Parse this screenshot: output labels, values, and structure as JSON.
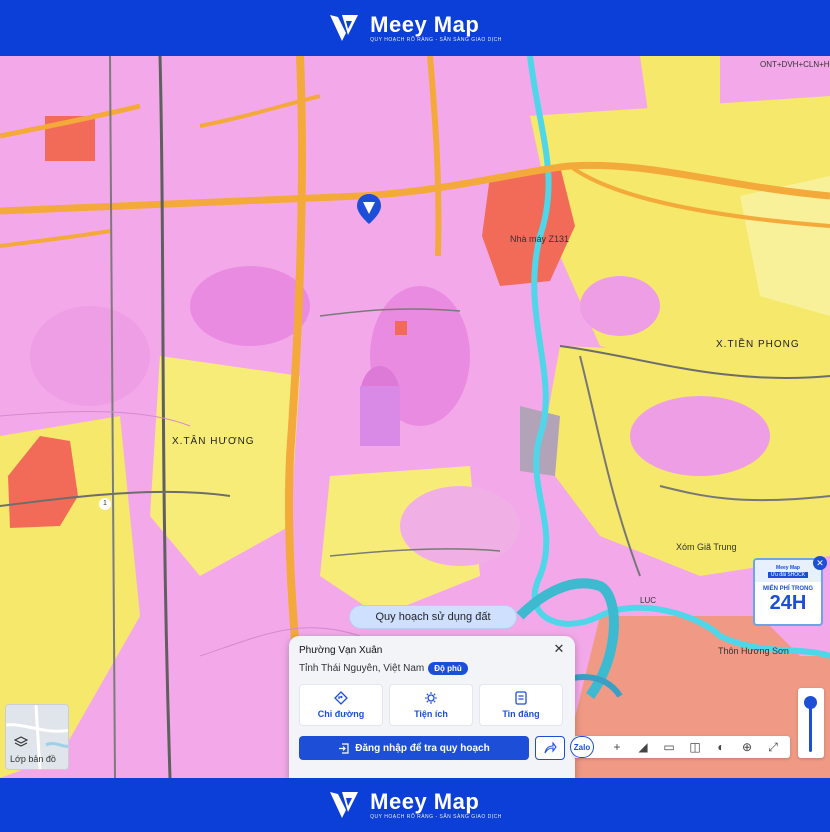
{
  "brand": {
    "name": "Meey Map",
    "tagline": "QUY HOẠCH RÕ RÀNG - SẴN SÀNG GIAO DỊCH"
  },
  "map": {
    "labels": {
      "factory": "Nhà máy Z131",
      "tien_phong": "X.TIỀN PHONG",
      "tan_huong": "X.TÂN HƯƠNG",
      "huong_son": "Thôn Hương Sơn",
      "xom_gia_trung": "Xóm Giã Trung",
      "road_1": "1",
      "luc": "LUC",
      "ont": "ONT+DVH+CLN+HNK"
    }
  },
  "plan_type_button": {
    "label": "Quy hoạch sử dụng đất"
  },
  "popup": {
    "title": "Phường Vạn Xuân",
    "location": "Tỉnh Thái Nguyên, Việt Nam",
    "badge": "Độ phủ",
    "actions": [
      {
        "label": "Chỉ đường",
        "icon": "directions-icon"
      },
      {
        "label": "Tiện ích",
        "icon": "amenities-icon"
      },
      {
        "label": "Tin đăng",
        "icon": "listing-icon"
      }
    ],
    "login_button": "Đăng nhập để tra quy hoạch",
    "close_symbol": "✕"
  },
  "layer_control": {
    "label": "Lớp bản đồ"
  },
  "toolbar": {
    "zalo": "Zalo",
    "items": [
      "−",
      "+",
      "◢",
      "▭",
      "◫",
      "◐",
      "⊕",
      "⤢"
    ]
  },
  "promo": {
    "brand": "Meey Map",
    "shock": "Ưu đãi SHOCK",
    "free_text": "MIỄN PHÍ TRONG",
    "hours": "24H"
  },
  "colors": {
    "brand_blue": "#0c3ed8",
    "residential_pink": "#f3a9e9",
    "agri_yellow": "#f5e86a",
    "road_orange": "#f4a93b",
    "industrial_red": "#f26b58",
    "river_cyan": "#4fd6e8"
  }
}
